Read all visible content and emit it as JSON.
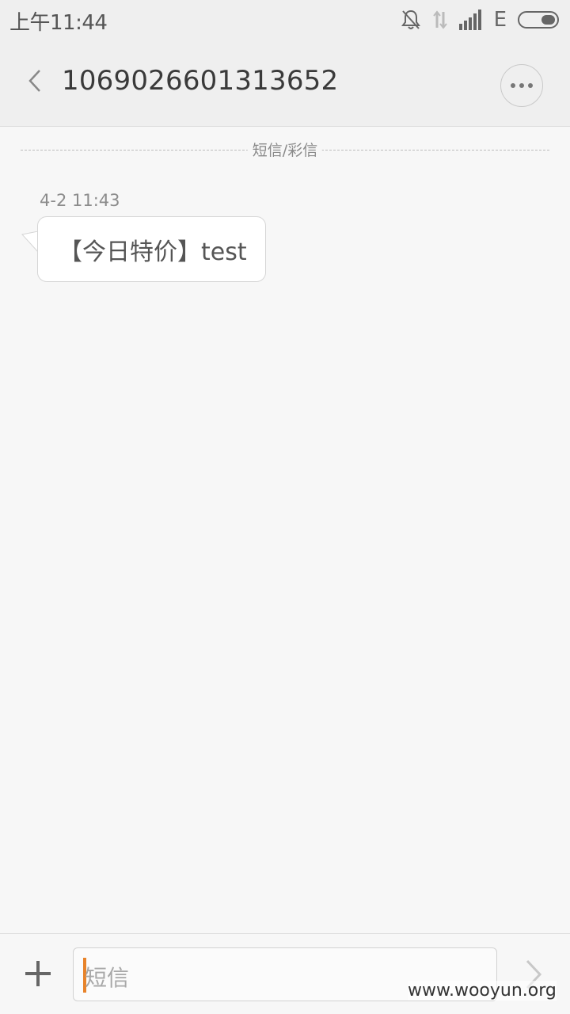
{
  "status_bar": {
    "time": "上午11:44",
    "network_type": "E",
    "icons": [
      "bell-muted-icon",
      "data-arrows-icon",
      "signal-bars-icon",
      "battery-icon"
    ]
  },
  "header": {
    "title": "1069026601313652",
    "back_icon": "chevron-left-icon",
    "more_icon": "more-dots-icon"
  },
  "conversation": {
    "divider_label": "短信/彩信",
    "messages": [
      {
        "time": "4-2 11:43",
        "text": "【今日特价】test",
        "direction": "incoming"
      }
    ]
  },
  "composer": {
    "placeholder": "短信",
    "add_icon": "plus-icon",
    "send_icon": "chevron-right-icon",
    "caret_color": "#e8832a"
  },
  "watermark": "www.wooyun.org"
}
